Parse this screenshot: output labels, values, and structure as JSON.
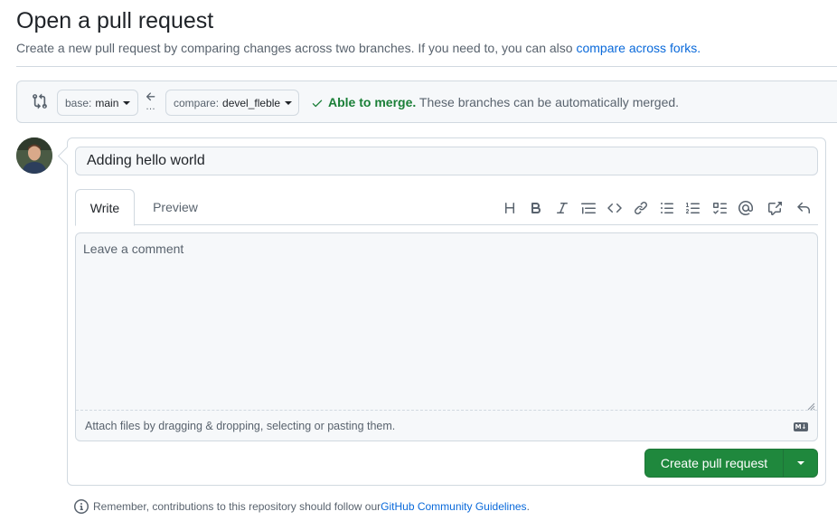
{
  "header": {
    "title": "Open a pull request",
    "subtitle": "Create a new pull request by comparing changes across two branches. If you need to, you can also ",
    "subtitle_link": "compare across forks."
  },
  "range": {
    "base_prefix": "base:",
    "base_branch": "main",
    "compare_prefix": "compare:",
    "compare_branch": "devel_fleble",
    "merge_status": "Able to merge.",
    "merge_detail": "These branches can be automatically merged."
  },
  "form": {
    "title_value": "Adding hello world",
    "tabs": [
      {
        "label": "Write",
        "selected": true
      },
      {
        "label": "Preview",
        "selected": false
      }
    ],
    "toolbar_icons": [
      "heading-icon",
      "bold-icon",
      "italic-icon",
      "quote-icon",
      "code-icon",
      "link-icon",
      "unordered-list-icon",
      "ordered-list-icon",
      "task-list-icon",
      "mention-icon",
      "cross-reference-icon",
      "reply-icon"
    ],
    "comment_placeholder": "Leave a comment",
    "attach_text": "Attach files by dragging & dropping, selecting or pasting them.",
    "submit_label": "Create pull request"
  },
  "footer": {
    "note": "Remember, contributions to this repository should follow our ",
    "link": "GitHub Community Guidelines",
    "end": "."
  },
  "colors": {
    "accent_link": "#0969da",
    "success": "#1a7f37",
    "primary_button": "#1f883d"
  }
}
